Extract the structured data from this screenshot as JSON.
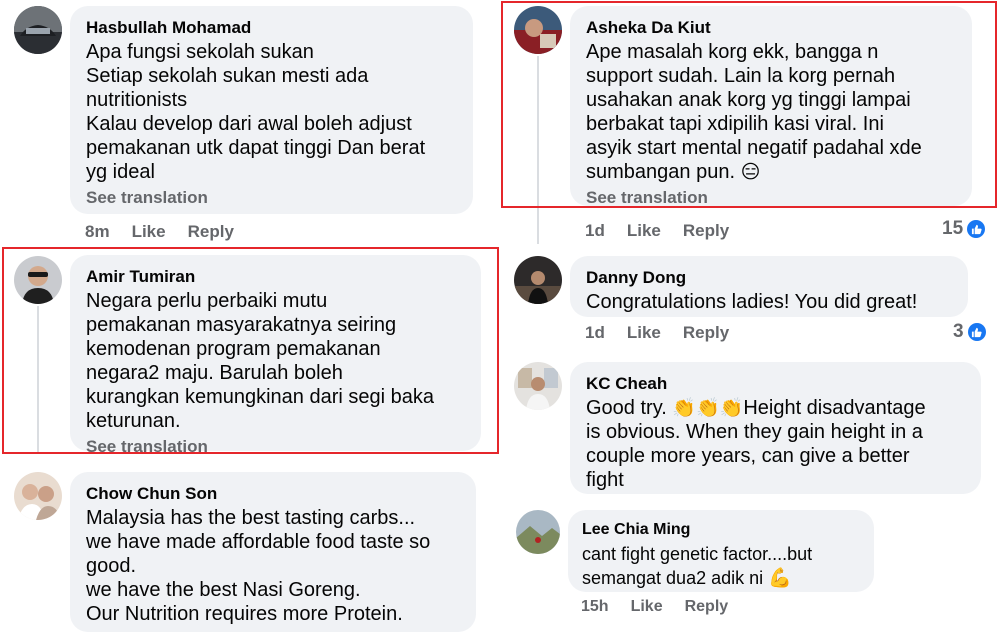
{
  "comments": [
    {
      "author": "Hasbullah Mohamad",
      "lines": [
        "Apa fungsi sekolah sukan",
        "Setiap sekolah sukan mesti ada",
        "nutritionists",
        "Kalau develop dari awal boleh adjust",
        "pemakanan utk dapat tinggi Dan berat",
        "yg ideal"
      ],
      "see_translation": "See translation",
      "time": "8m",
      "like": "Like",
      "reply": "Reply"
    },
    {
      "author": "Amir Tumiran",
      "lines": [
        "Negara perlu perbaiki mutu",
        "pemakanan masyarakatnya seiring",
        "kemodenan program pemakanan",
        "negara2 maju. Barulah boleh",
        "kurangkan kemungkinan dari segi baka",
        "keturunan."
      ],
      "see_translation": "See translation"
    },
    {
      "author": "Chow Chun Son",
      "lines": [
        "Malaysia has the best tasting carbs...",
        "we have made affordable food taste so",
        "good.",
        "we have the best Nasi Goreng.",
        "Our Nutrition requires more Protein."
      ]
    },
    {
      "author": "Asheka Da Kiut",
      "lines": [
        "Ape masalah korg ekk, bangga n",
        "support sudah. Lain la korg pernah",
        "usahakan anak korg yg tinggi lampai",
        "berbakat tapi xdipilih kasi viral. Ini",
        "asyik start mental negatif padahal xde",
        "sumbangan pun."
      ],
      "emoji": "😑",
      "see_translation": "See translation",
      "time": "1d",
      "like": "Like",
      "reply": "Reply",
      "reactions": "15"
    },
    {
      "author": "Danny Dong",
      "lines": [
        "Congratulations ladies! You did great!"
      ],
      "time": "1d",
      "like": "Like",
      "reply": "Reply",
      "reactions": "3"
    },
    {
      "author": "KC Cheah",
      "line1_pre": "Good try. ",
      "line1_emoji": "👏👏👏",
      "line1_post": "Height disadvantage",
      "lines": [
        "is obvious. When they gain height in a",
        "couple more years, can give a better",
        "fight"
      ]
    },
    {
      "author": "Lee Chia Ming",
      "lines": [
        "cant fight genetic factor....but"
      ],
      "line2_text": "semangat dua2 adik ni ",
      "line2_emoji": "💪",
      "time": "15h",
      "like": "Like",
      "reply": "Reply"
    }
  ],
  "colors": {
    "highlight": "#e5262b",
    "bubble": "#f0f2f5",
    "meta": "#65676b",
    "like_blue": "#1877f2"
  }
}
